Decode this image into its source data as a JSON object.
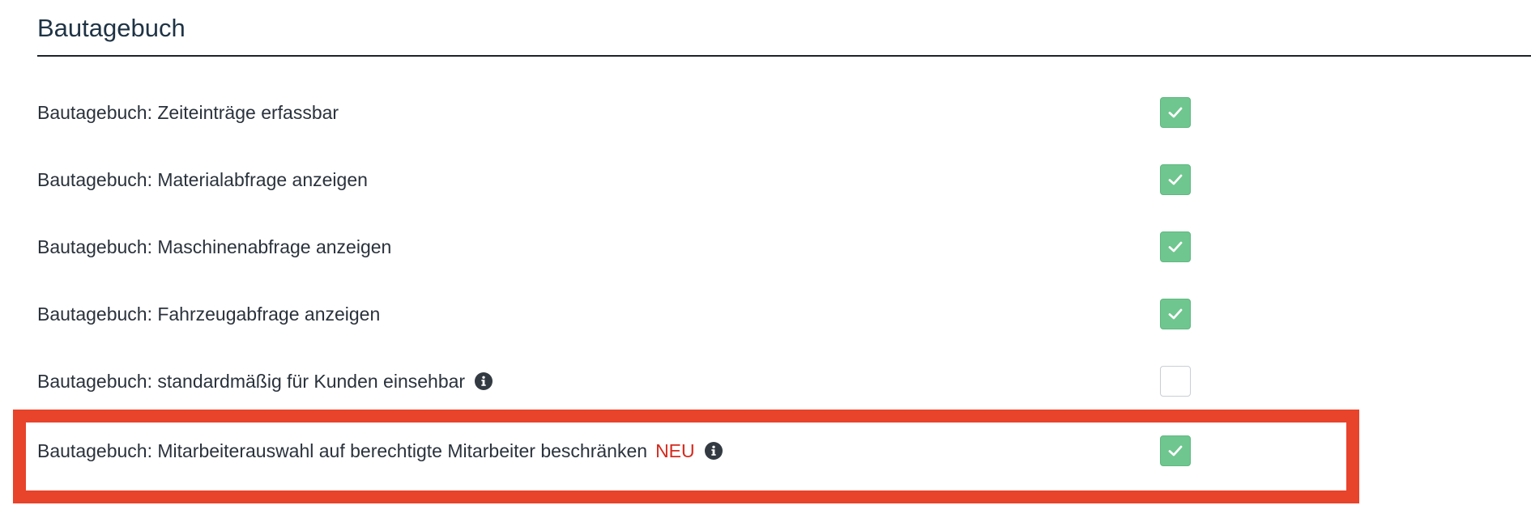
{
  "section": {
    "title": "Bautagebuch"
  },
  "settings": [
    {
      "label": "Bautagebuch: Zeiteinträge erfassbar",
      "checked": true,
      "badge": "",
      "info_icon": ""
    },
    {
      "label": "Bautagebuch: Materialabfrage anzeigen",
      "checked": true,
      "badge": "",
      "info_icon": ""
    },
    {
      "label": "Bautagebuch: Maschinenabfrage anzeigen",
      "checked": true,
      "badge": "",
      "info_icon": ""
    },
    {
      "label": "Bautagebuch: Fahrzeugabfrage anzeigen",
      "checked": true,
      "badge": "",
      "info_icon": ""
    },
    {
      "label": "Bautagebuch: standardmäßig für Kunden einsehbar",
      "checked": false,
      "badge": "",
      "info_icon": "info-icon"
    },
    {
      "label": "Bautagebuch: Mitarbeiterauswahl auf berechtigte Mitarbeiter beschränken",
      "checked": true,
      "badge": "NEU",
      "info_icon": "info-icon",
      "highlighted": true
    }
  ],
  "colors": {
    "checkbox_checked": "#6fc68f",
    "badge_new": "#d42a1e",
    "highlight_frame": "#e8432b",
    "title": "#1f3345"
  }
}
